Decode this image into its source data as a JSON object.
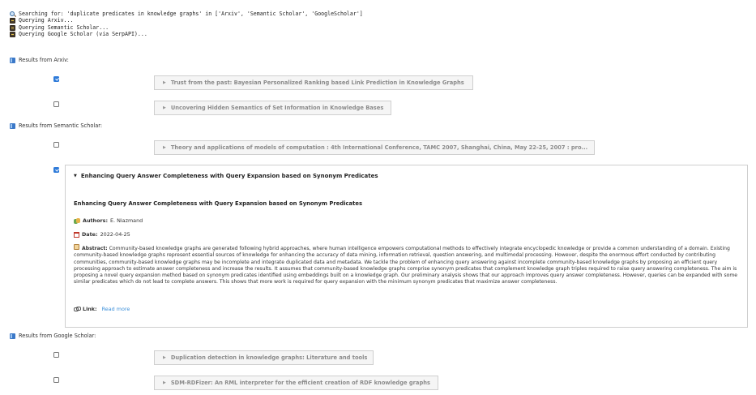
{
  "log": [
    {
      "icon": "magnifier-icon",
      "text": "Searching for: 'duplicate predicates in knowledge graphs' in ['Arxiv', 'Semantic Scholar', 'GoogleScholar']"
    },
    {
      "icon": "book-icon",
      "text": "Querying Arxiv..."
    },
    {
      "icon": "book-icon",
      "text": "Querying Semantic Scholar..."
    },
    {
      "icon": "book-icon",
      "text": "Querying Google Scholar (via SerpAPI)..."
    }
  ],
  "sections": {
    "arxiv": "Results from Arxiv:",
    "semantic": "Results from Semantic Scholar:",
    "google": "Results from Google Scholar:"
  },
  "results": [
    {
      "title": "Trust from the past: Bayesian Personalized Ranking based Link Prediction in Knowledge Graphs",
      "checked": true
    },
    {
      "title": "Uncovering Hidden Semantics of Set Information in Knowledge Bases",
      "checked": false
    },
    {
      "title": "Theory and applications of models of computation : 4th International Conference, TAMC 2007, Shanghai, China, May 22-25, 2007 : pro...",
      "checked": false
    },
    {
      "title": "Enhancing Query Answer Completeness with Query Expansion based on Synonym Predicates",
      "checked": true
    },
    {
      "title": "Duplication detection in knowledge graphs: Literature and tools",
      "checked": false
    },
    {
      "title": "SDM-RDFizer: An RML interpreter for the efficient creation of RDF knowledge graphs",
      "checked": false
    }
  ],
  "expanded": {
    "header": "Enhancing Query Answer Completeness with Query Expansion based on Synonym Predicates",
    "title": "Enhancing Query Answer Completeness with Query Expansion based on Synonym Predicates",
    "authors_label": "Authors:",
    "authors": "E. Niazmand",
    "date_label": "Date:",
    "date": "2022-04-25",
    "abstract_label": "Abstract:",
    "abstract": "Community-based knowledge graphs are generated following hybrid approaches, where human intelligence empowers computational methods to effectively integrate encyclopedic knowledge or provide a common understanding of a domain. Existing community-based knowledge graphs represent essential sources of knowledge for enhancing the accuracy of data mining, information retrieval, question answering, and multimodal processing. However, despite the enormous effort conducted by contributing communities, community-based knowledge graphs may be incomplete and integrate duplicated data and metadata. We tackle the problem of enhancing query answering against incomplete community-based knowledge graphs by proposing an efficient query processing approach to estimate answer completeness and increase the results. It assumes that community-based knowledge graphs comprise synonym predicates that complement knowledge graph triples required to raise query answering completeness. The aim is proposing a novel query expansion method based on synonym predicates identified using embeddings built on a knowledge graph. Our preliminary analysis shows that our approach improves query answer completeness. However, queries can be expanded with some similar predicates which do not lead to complete answers. This shows that more work is required for query expansion with the minimum synonym predicates that maximize answer completeness.",
    "link_label": "Link:",
    "link_text": "Read more"
  }
}
